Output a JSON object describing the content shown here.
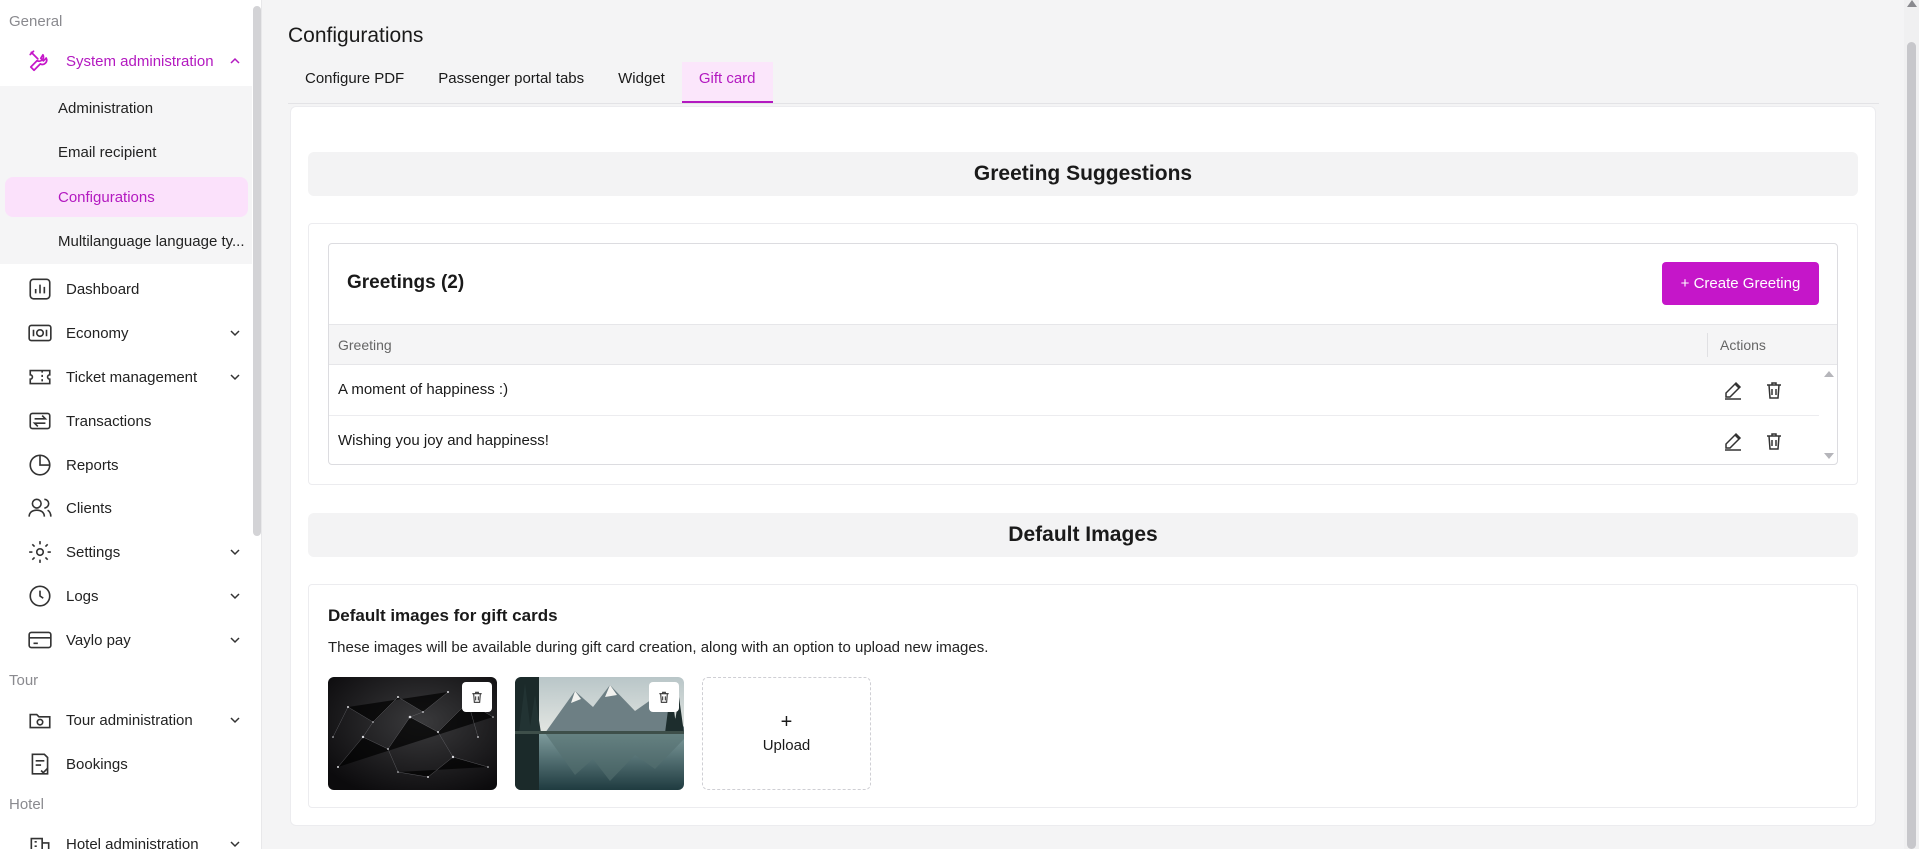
{
  "sidebar": {
    "section_general": "General",
    "section_tour": "Tour",
    "section_hotel": "Hotel",
    "system_admin": "System administration",
    "sub_items": [
      "Administration",
      "Email recipient",
      "Configurations",
      "Multilanguage language ty..."
    ],
    "items": [
      {
        "label": "Dashboard",
        "icon": "dashboard-icon"
      },
      {
        "label": "Economy",
        "icon": "economy-icon"
      },
      {
        "label": "Ticket management",
        "icon": "ticket-icon"
      },
      {
        "label": "Transactions",
        "icon": "transactions-icon"
      },
      {
        "label": "Reports",
        "icon": "reports-icon"
      },
      {
        "label": "Clients",
        "icon": "clients-icon"
      },
      {
        "label": "Settings",
        "icon": "gear-icon"
      },
      {
        "label": "Logs",
        "icon": "clock-icon"
      },
      {
        "label": "Vaylo pay",
        "icon": "card-icon"
      }
    ],
    "tour_items": [
      {
        "label": "Tour administration",
        "icon": "tour-icon"
      },
      {
        "label": "Bookings",
        "icon": "bookings-icon"
      }
    ],
    "hotel_items": [
      {
        "label": "Hotel administration",
        "icon": "hotel-icon"
      }
    ]
  },
  "main": {
    "title": "Configurations",
    "tabs": [
      "Configure PDF",
      "Passenger portal tabs",
      "Widget",
      "Gift card"
    ],
    "active_tab": "Gift card"
  },
  "greetings": {
    "section_title": "Greeting Suggestions",
    "grid_title": "Greetings (2)",
    "create_button": "+ Create Greeting",
    "col_greeting": "Greeting",
    "col_actions": "Actions",
    "rows": [
      "A moment of happiness :)",
      "Wishing you joy and happiness!"
    ]
  },
  "images": {
    "section_title": "Default Images",
    "title": "Default images for gift cards",
    "description": "These images will be available during gift card creation, along with an option to upload new images.",
    "upload_plus": "+",
    "upload_label": "Upload"
  },
  "colors": {
    "accent": "#c516c9",
    "accent_text": "#b319c0",
    "accent_bg": "#fbe1fb"
  }
}
